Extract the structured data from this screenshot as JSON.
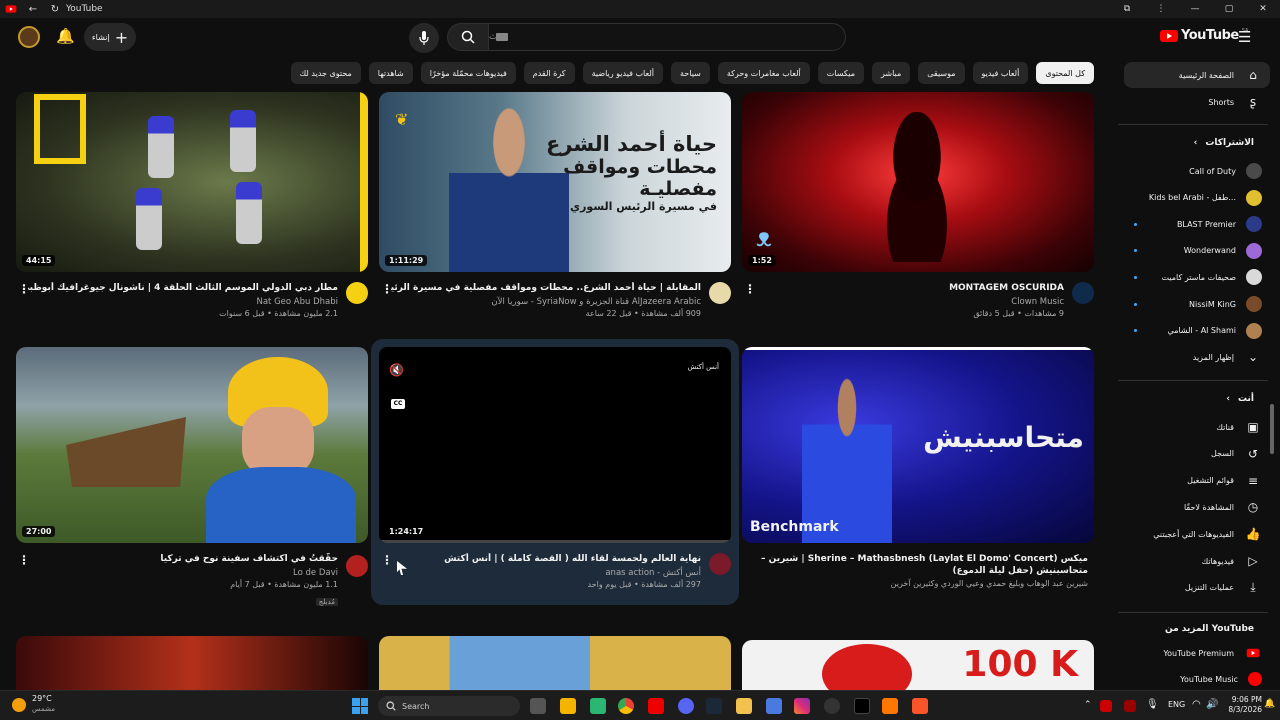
{
  "window": {
    "tab_title": "YouTube"
  },
  "masthead": {
    "logo_text": "YouTube",
    "logo_region": "SA",
    "search_placeholder": "بحث",
    "create_label": "إنشاء"
  },
  "chips": [
    "كل المحتوى",
    "ألعاب فيديو",
    "موسيقى",
    "مباشر",
    "ميكسات",
    "ألعاب مغامرات وحركة",
    "سياحة",
    "ألعاب فيديو رياضية",
    "كرة القدم",
    "فيديوهات محمّلة مؤخرًا",
    "شاهدتها",
    "محتوى جديد لك"
  ],
  "sidebar": {
    "home": "الصفحة الرئيسية",
    "shorts": "Shorts",
    "subscriptions_head": "الاشتراكات",
    "subscriptions": [
      {
        "name": "Call of Duty",
        "color": "#4a4a4a",
        "dot": false
      },
      {
        "name": "Kids bel Arabi - طفل...",
        "color": "#e0c030",
        "dot": false
      },
      {
        "name": "BLAST Premier",
        "color": "#2c3a8a",
        "dot": true
      },
      {
        "name": "Wonderwand",
        "color": "#9b6ad6",
        "dot": true
      },
      {
        "name": "صحيفات ماستر كاميت",
        "color": "#d9d9d9",
        "dot": true
      },
      {
        "name": "NissiM KinG",
        "color": "#7a4b2a",
        "dot": true
      },
      {
        "name": "الشامي - Al Shami",
        "color": "#b08050",
        "dot": true
      }
    ],
    "show_more": "إظهار المزيد",
    "you_head": "أنت",
    "you_items": [
      "قناتك",
      "السجل",
      "قوائم التشغيل",
      "المشاهدة لاحقًا",
      "الفيديوهات التي أعجبتني",
      "فيديوهاتك",
      "عمليات التنزيل"
    ],
    "more_from_head": "المزيد من YouTube",
    "more_from": [
      "YouTube Premium",
      "YouTube Music"
    ]
  },
  "videos": [
    {
      "title": "مطار دبي الدولي الموسم الثالث الحلقة 4 | ناشونال جيوغرافيك أبوظبي",
      "channel": "Nat Geo Abu Dhabi",
      "stats": "2.1 مليون مشاهدة • قبل 6 سنوات",
      "duration": "44:15"
    },
    {
      "title": "المقابلة | حياة أحمد الشرع.. محطات ومواقف مفصلية في مسيرة الرئيس السوري",
      "channel": "AlJazeera Arabic قناة الجزيرة و SyriaNow - سوريا الآن",
      "stats": "909 ألف مشاهدة • قبل 22 ساعة",
      "duration": "1:11:29",
      "thumb_text": [
        "حياة أحمد الشرع",
        "محطات ومواقف",
        "مفصليـة",
        "في مسيرة الرئيس السوري"
      ]
    },
    {
      "title": "MONTAGEM OSCURIDA",
      "channel": "Clown Music",
      "stats": "9 مشاهدات • قبل 5 دقائق",
      "duration": "1:52"
    },
    {
      "title": "حقّقتُ في اكتشاف سفينة نوح في تركيا",
      "channel": "Lo de Davi",
      "stats": "1.1 مليون مشاهدة • قبل 7 أيام",
      "duration": "27:00",
      "badge": "مُدبلج"
    },
    {
      "title": "نهاية العالم ولحمسة لقاء الله ( القصة كاملة ) | أنس أكتش",
      "channel": "أنس أكتش - anas action",
      "stats": "297 ألف مشاهدة • قبل يوم واحد",
      "duration": "1:24:17",
      "overlay_label": "أنس أكتش"
    },
    {
      "title": "ميكس Sherine – Mathasbnesh (Laylat El Domo' Concert) | شيرين – متحاسبنيش (حفل ليلة الدموع)",
      "channel": "شيرين عبد الوهاب وبليغ حمدي وعيي الوردي وكثيرين آخرين",
      "stats": "",
      "duration": "",
      "thumb_text": [
        "متحاسبنيش"
      ],
      "corner_label": "Benchmark"
    }
  ],
  "row3_thumb_text": [
    "100 K"
  ],
  "taskbar": {
    "weather_temp": "29°C",
    "weather_desc": "مشمس",
    "search_label": "Search",
    "lang": "ENG",
    "time": "9:06 PM",
    "date": "8/3/2026"
  }
}
